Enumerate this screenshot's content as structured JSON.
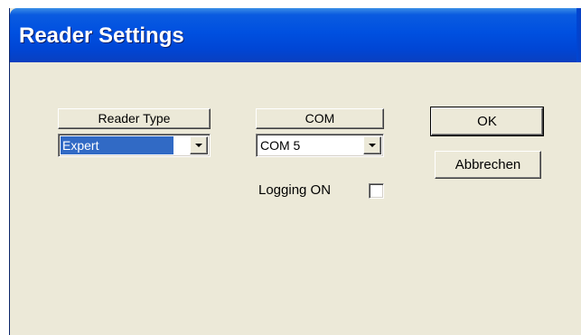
{
  "window": {
    "title": "Reader Settings"
  },
  "reader_type": {
    "header": "Reader Type",
    "selected": "Expert",
    "icon": "chevron-down-icon"
  },
  "com": {
    "header": "COM",
    "selected": "COM 5",
    "icon": "chevron-down-icon"
  },
  "logging": {
    "label": "Logging ON",
    "checked": false
  },
  "buttons": {
    "ok_label": "OK",
    "cancel_label": "Abbrechen"
  }
}
